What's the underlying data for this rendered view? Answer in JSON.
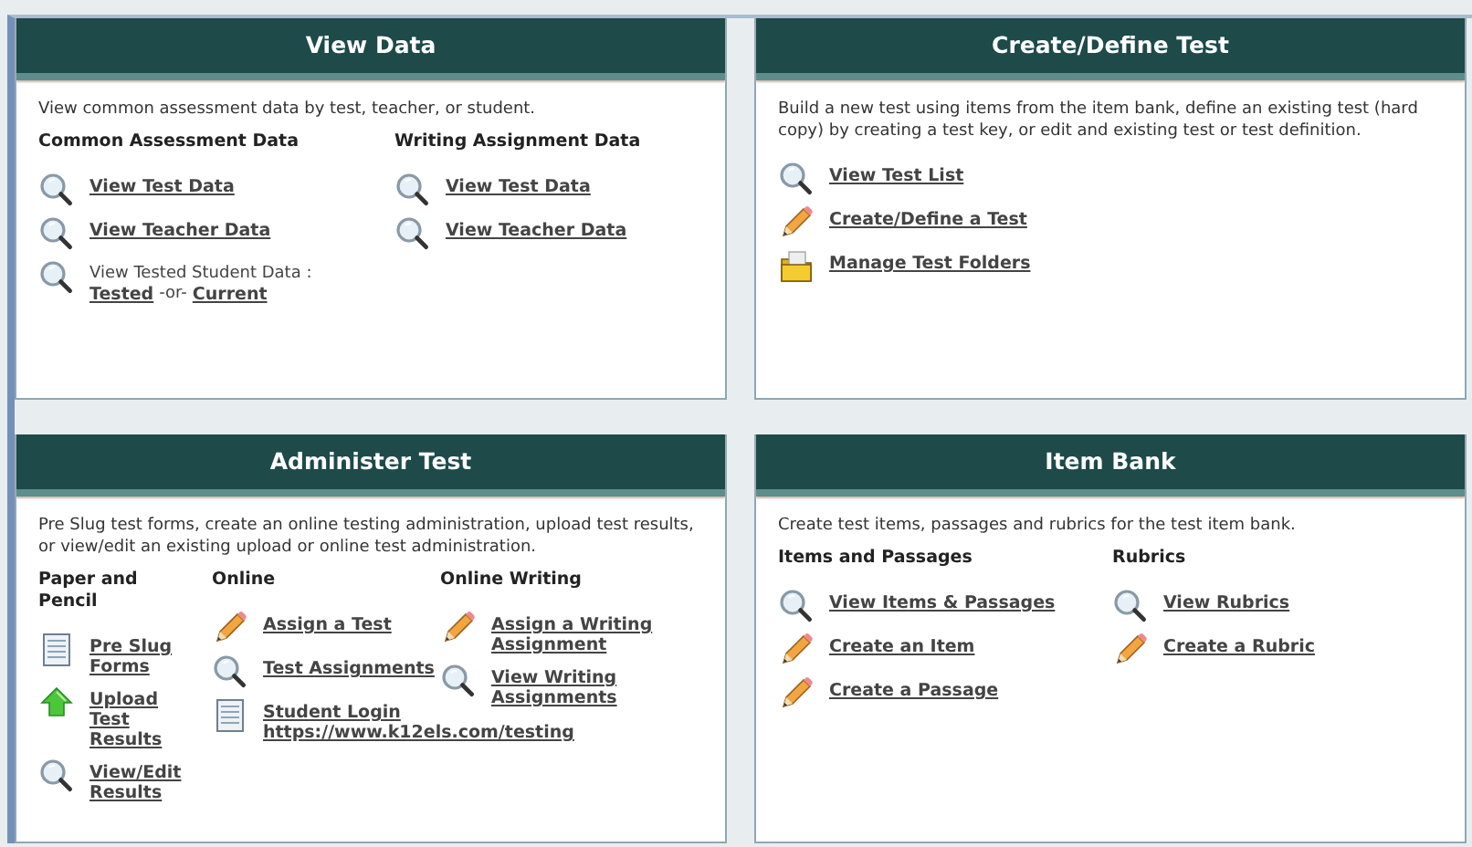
{
  "panels": [
    {
      "title": "View Data",
      "description": "View common assessment data by test, teacher, or student.",
      "columns": [
        {
          "heading": "Common Assessment Data",
          "items": [
            {
              "kind": "magnifier",
              "lines": [
                [
                  {
                    "kind": "link",
                    "text": "View Test Data"
                  }
                ]
              ]
            },
            {
              "kind": "magnifier",
              "lines": [
                [
                  {
                    "kind": "link",
                    "text": "View Teacher Data"
                  }
                ]
              ]
            },
            {
              "kind": "magnifier",
              "lines": [
                [
                  {
                    "kind": "text",
                    "text": "View Tested Student Data :"
                  }
                ],
                [
                  {
                    "kind": "link",
                    "text": "Tested "
                  },
                  {
                    "kind": "text",
                    "text": "-or-"
                  },
                  {
                    "kind": "link",
                    "text": "Current"
                  }
                ]
              ]
            }
          ]
        },
        {
          "heading": "Writing Assignment Data",
          "items": [
            {
              "kind": "magnifier",
              "lines": [
                [
                  {
                    "kind": "link",
                    "text": "View Test Data"
                  }
                ]
              ]
            },
            {
              "kind": "magnifier",
              "lines": [
                [
                  {
                    "kind": "link",
                    "text": "View Teacher Data"
                  }
                ]
              ]
            }
          ]
        }
      ]
    },
    {
      "title": "Create/Define Test",
      "description": "Build a new test using items from the item bank, define an existing test (hard copy) by creating a test key, or edit and existing test or test definition.",
      "columns": [
        {
          "items": [
            {
              "kind": "magnifier",
              "lines": [
                [
                  {
                    "kind": "link",
                    "text": "View Test List"
                  }
                ]
              ]
            },
            {
              "kind": "pencil",
              "lines": [
                [
                  {
                    "kind": "link",
                    "text": "Create/Define a Test"
                  }
                ]
              ]
            },
            {
              "kind": "folder",
              "lines": [
                [
                  {
                    "kind": "link",
                    "text": "Manage Test Folders"
                  }
                ]
              ]
            }
          ]
        }
      ]
    },
    {
      "title": "Administer Test",
      "description": "Pre Slug test forms, create an online testing administration, upload test results, or view/edit an existing upload or online test administration.",
      "columns": [
        {
          "heading": "Paper and Pencil",
          "items": [
            {
              "kind": "document",
              "lines": [
                [
                  {
                    "kind": "link",
                    "text": "Pre Slug"
                  }
                ],
                [
                  {
                    "kind": "link",
                    "text": "Forms"
                  }
                ]
              ]
            },
            {
              "kind": "arrow",
              "lines": [
                [
                  {
                    "kind": "link",
                    "text": "Upload"
                  }
                ],
                [
                  {
                    "kind": "link",
                    "text": "Test"
                  }
                ],
                [
                  {
                    "kind": "link",
                    "text": "Results"
                  }
                ]
              ]
            },
            {
              "kind": "magnifier",
              "lines": [
                [
                  {
                    "kind": "link",
                    "text": "View/Edit"
                  }
                ],
                [
                  {
                    "kind": "link",
                    "text": "Results"
                  }
                ]
              ]
            }
          ]
        },
        {
          "heading": "Online",
          "items": [
            {
              "kind": "pencil",
              "lines": [
                [
                  {
                    "kind": "link",
                    "text": "Assign a Test"
                  }
                ]
              ]
            },
            {
              "kind": "magnifier",
              "lines": [
                [
                  {
                    "kind": "link",
                    "text": "Test Assignments"
                  }
                ]
              ]
            },
            {
              "kind": "document",
              "lines": [
                [
                  {
                    "kind": "link",
                    "text": "Student Login"
                  }
                ],
                [
                  {
                    "kind": "link",
                    "text": "https://www.k12els.com/testing"
                  }
                ]
              ]
            }
          ]
        },
        {
          "heading": "Online Writing",
          "items": [
            {
              "kind": "pencil",
              "lines": [
                [
                  {
                    "kind": "link",
                    "text": "Assign a Writing"
                  }
                ],
                [
                  {
                    "kind": "link",
                    "text": "Assignment"
                  }
                ]
              ]
            },
            {
              "kind": "magnifier",
              "lines": [
                [
                  {
                    "kind": "link",
                    "text": "View Writing"
                  }
                ],
                [
                  {
                    "kind": "link",
                    "text": "Assignments"
                  }
                ]
              ]
            }
          ]
        }
      ]
    },
    {
      "title": "Item Bank",
      "description": "Create test items, passages and rubrics for the test item bank.",
      "columns": [
        {
          "heading": "Items and Passages",
          "items": [
            {
              "kind": "magnifier",
              "lines": [
                [
                  {
                    "kind": "link",
                    "text": "View Items & Passages"
                  }
                ]
              ]
            },
            {
              "kind": "pencil",
              "lines": [
                [
                  {
                    "kind": "link",
                    "text": "Create an Item"
                  }
                ]
              ]
            },
            {
              "kind": "pencil",
              "lines": [
                [
                  {
                    "kind": "link",
                    "text": "Create a Passage"
                  }
                ]
              ]
            }
          ]
        },
        {
          "heading": "Rubrics",
          "items": [
            {
              "kind": "magnifier",
              "lines": [
                [
                  {
                    "kind": "link",
                    "text": "View Rubrics"
                  }
                ]
              ]
            },
            {
              "kind": "pencil",
              "lines": [
                [
                  {
                    "kind": "link",
                    "text": "Create a Rubric"
                  }
                ]
              ]
            }
          ]
        }
      ]
    }
  ]
}
